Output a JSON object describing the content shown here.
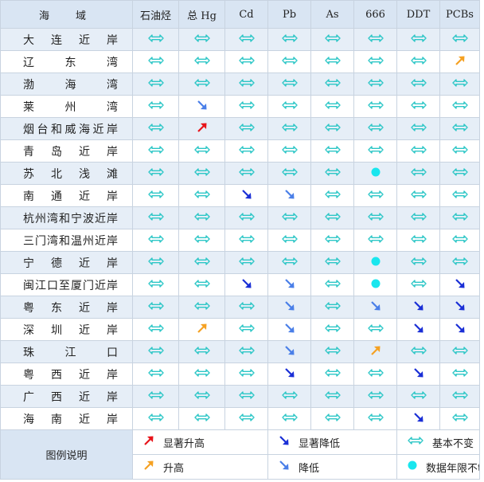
{
  "columns": [
    "海　域",
    "石油烃",
    "总 Hg",
    "Cd",
    "Pb",
    "As",
    "666",
    "DDT",
    "PCBs"
  ],
  "rows": [
    {
      "region": "大连近岸",
      "trends": [
        "stable",
        "stable",
        "stable",
        "stable",
        "stable",
        "stable",
        "stable",
        "stable"
      ]
    },
    {
      "region": "辽东湾",
      "trends": [
        "stable",
        "stable",
        "stable",
        "stable",
        "stable",
        "stable",
        "stable",
        "rise"
      ]
    },
    {
      "region": "渤海湾",
      "trends": [
        "stable",
        "stable",
        "stable",
        "stable",
        "stable",
        "stable",
        "stable",
        "stable"
      ]
    },
    {
      "region": "莱州湾",
      "trends": [
        "stable",
        "decrease",
        "stable",
        "stable",
        "stable",
        "stable",
        "stable",
        "stable"
      ]
    },
    {
      "region": "烟台和威海近岸",
      "trends": [
        "stable",
        "sig_rise",
        "stable",
        "stable",
        "stable",
        "stable",
        "stable",
        "stable"
      ]
    },
    {
      "region": "青岛近岸",
      "trends": [
        "stable",
        "stable",
        "stable",
        "stable",
        "stable",
        "stable",
        "stable",
        "stable"
      ]
    },
    {
      "region": "苏北浅滩",
      "trends": [
        "stable",
        "stable",
        "stable",
        "stable",
        "stable",
        "insufficient",
        "stable",
        "stable"
      ]
    },
    {
      "region": "南通近岸",
      "trends": [
        "stable",
        "stable",
        "sig_decrease",
        "decrease",
        "stable",
        "stable",
        "stable",
        "stable"
      ]
    },
    {
      "region": "杭州湾和宁波近岸",
      "trends": [
        "stable",
        "stable",
        "stable",
        "stable",
        "stable",
        "stable",
        "stable",
        "stable"
      ]
    },
    {
      "region": "三门湾和温州近岸",
      "trends": [
        "stable",
        "stable",
        "stable",
        "stable",
        "stable",
        "stable",
        "stable",
        "stable"
      ]
    },
    {
      "region": "宁德近岸",
      "trends": [
        "stable",
        "stable",
        "stable",
        "stable",
        "stable",
        "insufficient",
        "stable",
        "stable"
      ]
    },
    {
      "region": "闽江口至厦门近岸",
      "trends": [
        "stable",
        "stable",
        "sig_decrease",
        "decrease",
        "stable",
        "insufficient",
        "stable",
        "sig_decrease"
      ]
    },
    {
      "region": "粤东近岸",
      "trends": [
        "stable",
        "stable",
        "stable",
        "decrease",
        "stable",
        "decrease",
        "sig_decrease",
        "sig_decrease"
      ]
    },
    {
      "region": "深圳近岸",
      "trends": [
        "stable",
        "rise",
        "stable",
        "decrease",
        "stable",
        "stable",
        "sig_decrease",
        "sig_decrease"
      ]
    },
    {
      "region": "珠江口",
      "trends": [
        "stable",
        "stable",
        "stable",
        "decrease",
        "stable",
        "rise",
        "stable",
        "stable"
      ]
    },
    {
      "region": "粤西近岸",
      "trends": [
        "stable",
        "stable",
        "stable",
        "sig_decrease",
        "stable",
        "stable",
        "sig_decrease",
        "stable"
      ]
    },
    {
      "region": "广西近岸",
      "trends": [
        "stable",
        "stable",
        "stable",
        "stable",
        "stable",
        "stable",
        "stable",
        "stable"
      ]
    },
    {
      "region": "海南近岸",
      "trends": [
        "stable",
        "stable",
        "stable",
        "stable",
        "stable",
        "stable",
        "sig_decrease",
        "stable"
      ]
    }
  ],
  "legend": {
    "title": "图例说明",
    "items": [
      {
        "key": "sig_rise",
        "label": "显著升高"
      },
      {
        "key": "sig_decrease",
        "label": "显著降低"
      },
      {
        "key": "stable",
        "label": "基本不变"
      },
      {
        "key": "rise",
        "label": "升高"
      },
      {
        "key": "decrease",
        "label": "降低"
      },
      {
        "key": "insufficient",
        "label": "数据年限不够"
      }
    ]
  },
  "icons": {
    "stable": {
      "name": "double-arrow-icon",
      "color": "#2bc6c6"
    },
    "sig_rise": {
      "name": "arrow-up-right-icon",
      "color": "#e8141a"
    },
    "rise": {
      "name": "arrow-up-right-icon",
      "color": "#f5a122"
    },
    "sig_decrease": {
      "name": "arrow-down-right-icon",
      "color": "#1a2fd6"
    },
    "decrease": {
      "name": "arrow-down-right-icon",
      "color": "#4a7fe8"
    },
    "insufficient": {
      "name": "dot-icon",
      "color": "#19e6ee"
    }
  }
}
